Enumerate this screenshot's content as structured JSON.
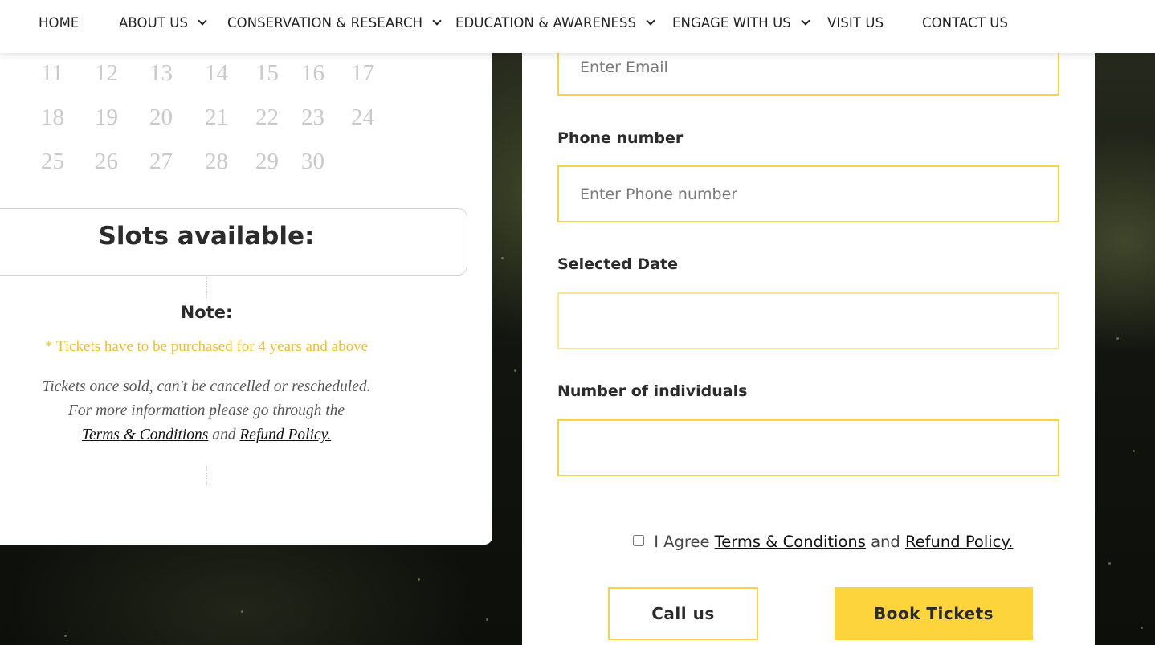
{
  "nav": {
    "items": [
      {
        "label": "HOME",
        "has_dropdown": false
      },
      {
        "label": "ABOUT US",
        "has_dropdown": true
      },
      {
        "label": "CONSERVATION & RESEARCH",
        "has_dropdown": true
      },
      {
        "label": "EDUCATION & AWARENESS",
        "has_dropdown": true
      },
      {
        "label": "ENGAGE WITH US",
        "has_dropdown": true
      },
      {
        "label": "VISIT US",
        "has_dropdown": false
      },
      {
        "label": "CONTACT US",
        "has_dropdown": false
      }
    ]
  },
  "calendar": {
    "weeks": [
      [
        "11",
        "12",
        "13",
        "14",
        "15",
        "16",
        "17"
      ],
      [
        "18",
        "19",
        "20",
        "21",
        "22",
        "23",
        "24"
      ],
      [
        "25",
        "26",
        "27",
        "28",
        "29",
        "30"
      ]
    ]
  },
  "slots": {
    "title": "Slots available:"
  },
  "note": {
    "title": "Note:",
    "age_rule": "* Tickets have to be purchased for 4 years and above",
    "line1": "Tickets once sold, can't be cancelled or rescheduled.",
    "line2": "For more information please go through the",
    "terms_link": "Terms & Conditions",
    "and": "and",
    "refund_link": "Refund Policy."
  },
  "form": {
    "email": {
      "placeholder": "Enter Email",
      "value": ""
    },
    "phone": {
      "label": "Phone number",
      "placeholder": "Enter Phone number",
      "value": ""
    },
    "date": {
      "label": "Selected Date",
      "value": ""
    },
    "individuals": {
      "label": "Number of individuals",
      "value": ""
    },
    "agree": {
      "prefix": "I Agree",
      "terms_link": "Terms & Conditions",
      "and": "and",
      "refund_link": "Refund Policy.",
      "checked": false
    },
    "call_button": "Call us",
    "book_button": "Book Tickets"
  },
  "colors": {
    "accent": "#fdd43c",
    "border": "#f7d24b",
    "note_yellow": "#f2be2f"
  }
}
